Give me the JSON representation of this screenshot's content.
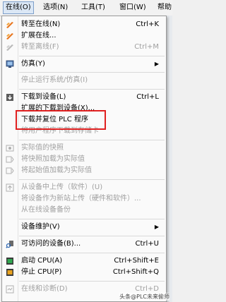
{
  "menubar": {
    "items": [
      "在线(O)",
      "选项(N)",
      "工具(T)",
      "窗口(W)",
      "帮助"
    ]
  },
  "menu": {
    "go_online": {
      "label": "转至在线(N)",
      "shortcut": "Ctrl+K"
    },
    "extended_online": {
      "label": "扩展在线..."
    },
    "go_offline": {
      "label": "转至离线(F)",
      "shortcut": "Ctrl+M"
    },
    "simulation": {
      "label": "仿真(Y)"
    },
    "stop_runtime": {
      "label": "停止运行系统/仿真(I)"
    },
    "download_to_device": {
      "label": "下载到设备(L)",
      "shortcut": "Ctrl+L"
    },
    "extended_download": {
      "label": "扩展的下载到设备(X)..."
    },
    "download_reset": {
      "label": "下载并复位 PLC 程序"
    },
    "download_user_program": {
      "label": "将用户程序下载到存储卡"
    },
    "snapshot": {
      "label": "实际值的快照"
    },
    "load_snapshot": {
      "label": "将快照加载为实际值"
    },
    "load_start_values": {
      "label": "将起始值加载为实际值"
    },
    "upload_from_device": {
      "label": "从设备中上传（软件）(U)"
    },
    "upload_as_new": {
      "label": "将设备作为新站上传（硬件和软件）..."
    },
    "upload_online_backup": {
      "label": "从在线设备备份"
    },
    "device_maintenance": {
      "label": "设备维护(V)"
    },
    "accessible_devices": {
      "label": "可访问的设备(B)...",
      "shortcut": "Ctrl+U"
    },
    "start_cpu": {
      "label": "启动 CPU(A)",
      "shortcut": "Ctrl+Shift+E"
    },
    "stop_cpu": {
      "label": "停止 CPU(P)",
      "shortcut": "Ctrl+Shift+Q"
    },
    "online_diagnostics": {
      "label": "在线和诊断(D)",
      "shortcut": "Ctrl+D"
    }
  },
  "watermark": "头条@PLC未来偷师",
  "colors": {
    "highlight_border": "#e02020",
    "menubar_active": "#dbe7f5"
  }
}
